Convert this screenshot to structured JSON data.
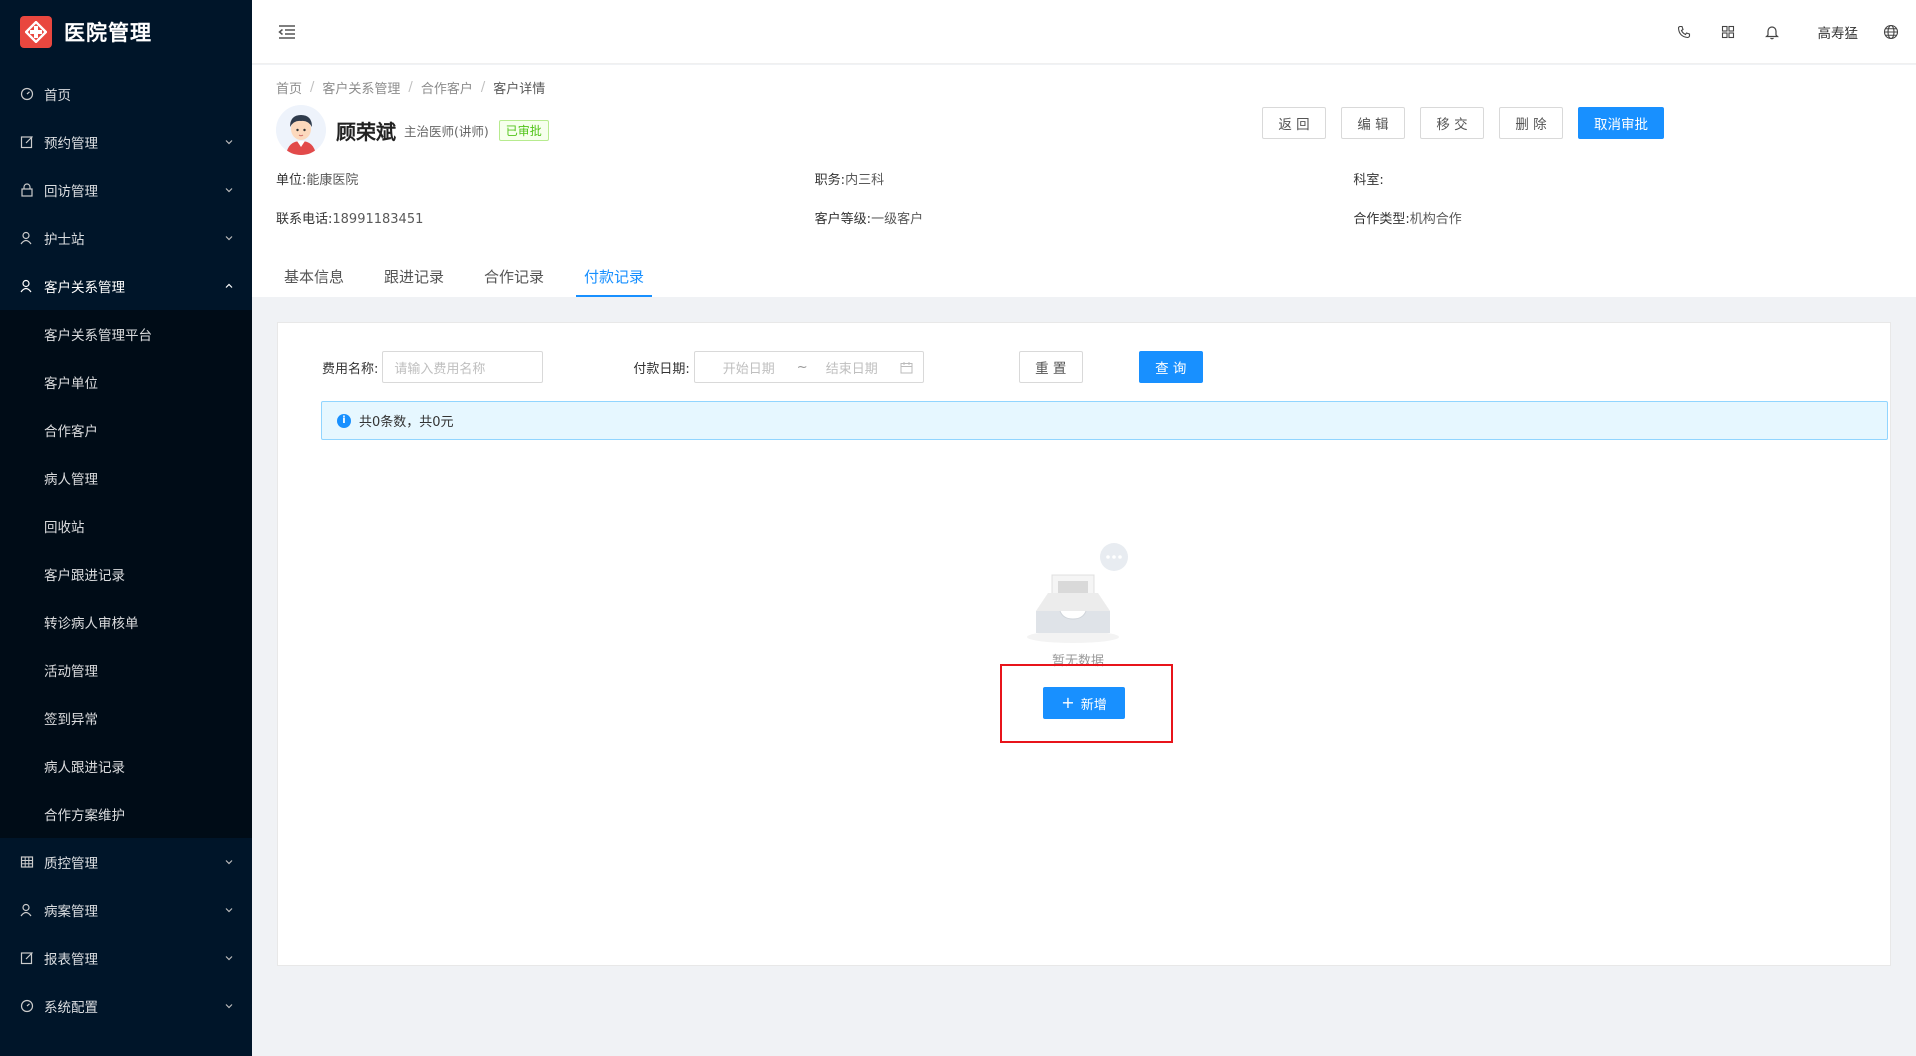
{
  "app": {
    "title": "医院管理",
    "brand_color": "#e9473f",
    "sidebar_bg": "#001529",
    "accent": "#1890ff"
  },
  "sidebar": {
    "items": [
      {
        "label": "首页",
        "icon": "dashboard-icon",
        "has_arrow": false
      },
      {
        "label": "预约管理",
        "icon": "edit-icon",
        "has_arrow": true
      },
      {
        "label": "回访管理",
        "icon": "lock-icon",
        "has_arrow": true
      },
      {
        "label": "护士站",
        "icon": "user-icon",
        "has_arrow": true
      },
      {
        "label": "客户关系管理",
        "icon": "user-icon",
        "has_arrow": true,
        "open": true
      }
    ],
    "sub_items": [
      "客户关系管理平台",
      "客户单位",
      "合作客户",
      "病人管理",
      "回收站",
      "客户跟进记录",
      "转诊病人审核单",
      "活动管理",
      "签到异常",
      "病人跟进记录",
      "合作方案维护"
    ],
    "items_after": [
      {
        "label": "质控管理",
        "icon": "table-icon",
        "has_arrow": true
      },
      {
        "label": "病案管理",
        "icon": "user-icon",
        "has_arrow": true
      },
      {
        "label": "报表管理",
        "icon": "edit-icon",
        "has_arrow": true
      },
      {
        "label": "系统配置",
        "icon": "dashboard-icon",
        "has_arrow": true
      }
    ]
  },
  "header": {
    "user": "高寿猛",
    "icons": [
      "phone-icon",
      "grid-icon",
      "bell-icon",
      "globe-icon"
    ]
  },
  "breadcrumb": [
    "首页",
    "客户关系管理",
    "合作客户",
    "客户详情"
  ],
  "profile": {
    "name": "顾荣斌",
    "title": "主治医师(讲师)",
    "status": "已审批"
  },
  "actions": {
    "back": "返 回",
    "edit": "编 辑",
    "transfer": "移 交",
    "delete": "删 除",
    "cancel_approval": "取消审批"
  },
  "info": {
    "unit_label": "单位:",
    "unit_value": "能康医院",
    "position_label": "职务:",
    "position_value": "内三科",
    "dept_label": "科室:",
    "dept_value": "",
    "phone_label": "联系电话:",
    "phone_value": "18991183451",
    "level_label": "客户等级:",
    "level_value": "一级客户",
    "coop_label": "合作类型:",
    "coop_value": "机构合作"
  },
  "tabs": [
    "基本信息",
    "跟进记录",
    "合作记录",
    "付款记录"
  ],
  "active_tab": 3,
  "filter": {
    "fee_label": "费用名称:",
    "fee_placeholder": "请输入费用名称",
    "date_label": "付款日期:",
    "date_start": "开始日期",
    "date_sep": "~",
    "date_end": "结束日期",
    "reset": "重 置",
    "query": "查 询"
  },
  "summary": "共0条数，共0元",
  "empty_text": "暂无数据",
  "add_button": "新增"
}
